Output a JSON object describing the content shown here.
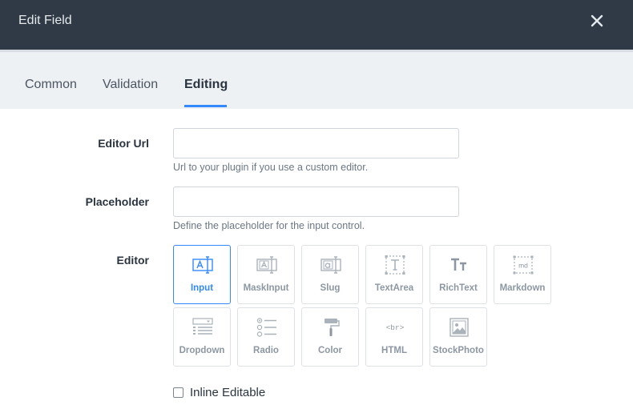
{
  "header": {
    "title": "Edit Field"
  },
  "tabs": [
    {
      "label": "Common"
    },
    {
      "label": "Validation"
    },
    {
      "label": "Editing"
    }
  ],
  "fields": {
    "editor_url": {
      "label": "Editor Url",
      "value": "",
      "placeholder": "",
      "hint": "Url to your plugin if you use a custom editor."
    },
    "placeholder": {
      "label": "Placeholder",
      "value": "",
      "placeholder": "",
      "hint": "Define the placeholder for the input control."
    },
    "editor": {
      "label": "Editor",
      "selected": "Input"
    }
  },
  "editors": [
    {
      "label": "Input",
      "icon": "input-icon"
    },
    {
      "label": "MaskInput",
      "icon": "mask-input-icon"
    },
    {
      "label": "Slug",
      "icon": "slug-icon"
    },
    {
      "label": "TextArea",
      "icon": "textarea-icon"
    },
    {
      "label": "RichText",
      "icon": "richtext-icon"
    },
    {
      "label": "Markdown",
      "icon": "markdown-icon"
    },
    {
      "label": "Dropdown",
      "icon": "dropdown-icon"
    },
    {
      "label": "Radio",
      "icon": "radio-icon"
    },
    {
      "label": "Color",
      "icon": "color-icon"
    },
    {
      "label": "HTML",
      "icon": "html-icon"
    },
    {
      "label": "StockPhoto",
      "icon": "stock-photo-icon"
    }
  ],
  "icon_text": {
    "html": "<br>",
    "markdown": "md"
  },
  "inline_editable": {
    "label": "Inline Editable",
    "checked": false
  },
  "colors": {
    "accent": "#3389ff",
    "header_bg": "#2f3a46",
    "tab_bg": "#eef1f4",
    "icon_gray": "#8d97a3"
  }
}
